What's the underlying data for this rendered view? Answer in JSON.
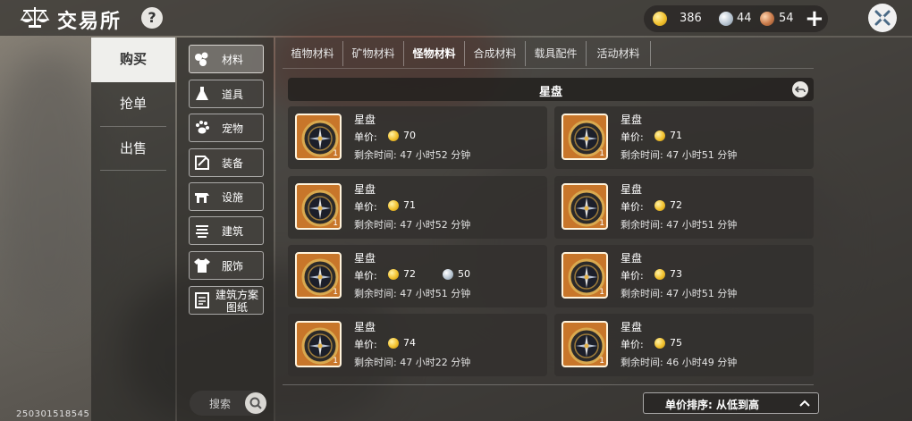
{
  "header": {
    "title": "交易所",
    "help_label": "?",
    "logo_icon": "scales-icon",
    "currencies": [
      {
        "icon": "gold-coin-icon",
        "value": "386"
      },
      {
        "icon": "silver-coin-icon",
        "value": "44"
      },
      {
        "icon": "copper-coin-icon",
        "value": "54"
      }
    ],
    "add_label": "+"
  },
  "main_nav": {
    "items": [
      {
        "label": "购买",
        "active": true
      },
      {
        "label": "抢单",
        "active": false
      },
      {
        "label": "出售",
        "active": false
      }
    ]
  },
  "categories": [
    {
      "label": "材料",
      "icon": "materials-icon",
      "active": true
    },
    {
      "label": "道具",
      "icon": "flask-icon",
      "active": false
    },
    {
      "label": "宠物",
      "icon": "paw-icon",
      "active": false
    },
    {
      "label": "装备",
      "icon": "equipment-icon",
      "active": false
    },
    {
      "label": "设施",
      "icon": "facility-icon",
      "active": false
    },
    {
      "label": "建筑",
      "icon": "building-icon",
      "active": false
    },
    {
      "label": "服饰",
      "icon": "clothing-icon",
      "active": false
    },
    {
      "label": "建筑方案\n图纸",
      "label_line1": "建筑方案",
      "label_line2": "图纸",
      "icon": "blueprint-icon",
      "active": false
    }
  ],
  "search": {
    "placeholder": "搜索"
  },
  "build_code": "250301518545",
  "tabs": [
    {
      "label": "植物材料",
      "active": false
    },
    {
      "label": "矿物材料",
      "active": false
    },
    {
      "label": "怪物材料",
      "active": true
    },
    {
      "label": "合成材料",
      "active": false
    },
    {
      "label": "载具配件",
      "active": false
    },
    {
      "label": "活动材料",
      "active": false
    }
  ],
  "subheader": {
    "title": "星盘"
  },
  "listings": [
    {
      "name": "星盘",
      "qty": "1",
      "price_label": "单价:",
      "price": "70",
      "alt_price": null,
      "time_left": "剩余时间: 47 小时52 分钟"
    },
    {
      "name": "星盘",
      "qty": "1",
      "price_label": "单价:",
      "price": "71",
      "alt_price": null,
      "time_left": "剩余时间: 47 小时51 分钟"
    },
    {
      "name": "星盘",
      "qty": "1",
      "price_label": "单价:",
      "price": "71",
      "alt_price": null,
      "time_left": "剩余时间: 47 小时52 分钟"
    },
    {
      "name": "星盘",
      "qty": "1",
      "price_label": "单价:",
      "price": "72",
      "alt_price": null,
      "time_left": "剩余时间: 47 小时51 分钟"
    },
    {
      "name": "星盘",
      "qty": "1",
      "price_label": "单价:",
      "price": "72",
      "alt_price": "50",
      "time_left": "剩余时间: 47 小时51 分钟"
    },
    {
      "name": "星盘",
      "qty": "1",
      "price_label": "单价:",
      "price": "73",
      "alt_price": null,
      "time_left": "剩余时间: 47 小时51 分钟"
    },
    {
      "name": "星盘",
      "qty": "1",
      "price_label": "单价:",
      "price": "74",
      "alt_price": null,
      "time_left": "剩余时间: 47 小时22 分钟"
    },
    {
      "name": "星盘",
      "qty": "1",
      "price_label": "单价:",
      "price": "75",
      "alt_price": null,
      "time_left": "剩余时间: 46 小时49 分钟"
    }
  ],
  "sort": {
    "label": "单价排序: 从低到高"
  }
}
